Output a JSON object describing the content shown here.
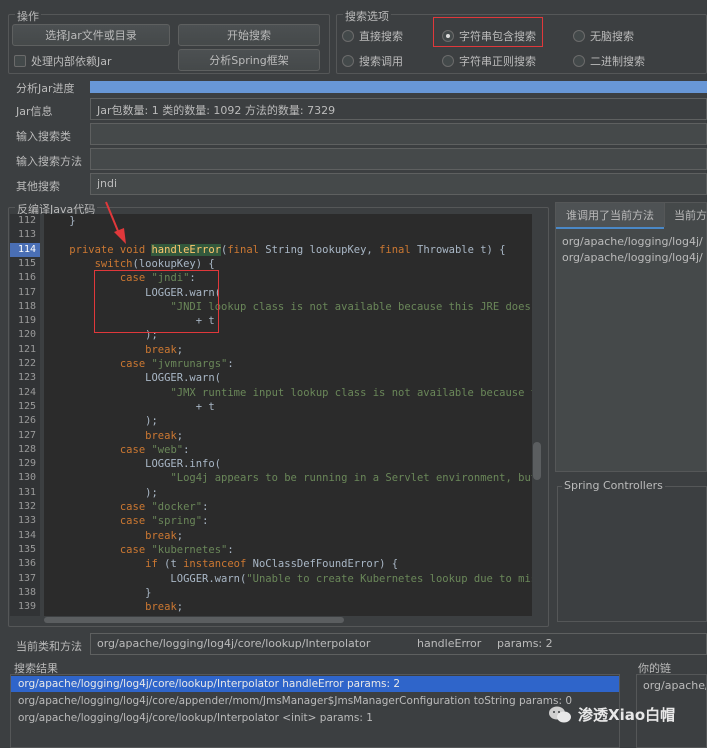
{
  "ops": {
    "title": "操作",
    "select_jar": "选择Jar文件或目录",
    "start_search": "开始搜索",
    "inner_jar": "处理内部依赖Jar",
    "analyze_spring": "分析Spring框架"
  },
  "search_opts": {
    "title": "搜索选项",
    "options": [
      "直接搜索",
      "字符串包含搜索",
      "无脑搜索",
      "搜索调用",
      "字符串正则搜索",
      "二进制搜索"
    ],
    "selected": "字符串包含搜索"
  },
  "fields": {
    "progress_label": "分析Jar进度",
    "jarinfo_label": "Jar信息",
    "jarinfo_value": "Jar包数量: 1    类的数量: 1092    方法的数量: 7329",
    "class_label": "输入搜索类",
    "class_value": "",
    "method_label": "输入搜索方法",
    "method_value": "",
    "other_label": "其他搜索",
    "other_value": "jndi"
  },
  "decompile_title": "反编译Java代码",
  "code": {
    "lines": [
      "112",
      "113",
      "114",
      "115",
      "116",
      "117",
      "118",
      "119",
      "120",
      "121",
      "122",
      "123",
      "124",
      "125",
      "126",
      "127",
      "128",
      "129",
      "130",
      "131",
      "132",
      "133",
      "134",
      "135",
      "136",
      "137",
      "138",
      "139"
    ]
  },
  "right": {
    "tab_callers": "谁调用了当前方法",
    "tab_callees": "当前方",
    "items": [
      "org/apache/logging/log4j/",
      "org/apache/logging/log4j/"
    ],
    "spring_title": "Spring Controllers"
  },
  "current": {
    "label": "当前类和方法",
    "cls": "org/apache/logging/log4j/core/lookup/Interpolator",
    "method": "handleError",
    "params": "params: 2"
  },
  "results": {
    "title": "搜索结果",
    "rows": [
      "org/apache/logging/log4j/core/lookup/Interpolator  handleError  params: 2",
      "org/apache/logging/log4j/core/appender/mom/JmsManager$JmsManagerConfiguration  toString  params: 0",
      "org/apache/logging/log4j/core/lookup/Interpolator   <init>   params: 1"
    ]
  },
  "chain": {
    "title": "你的链",
    "item": "org/apache/"
  },
  "watermark": "渗透Xiao白帽",
  "colors": {
    "accent": "#6897d6",
    "annotation": "#e0383b",
    "selection": "#2f65ca"
  }
}
